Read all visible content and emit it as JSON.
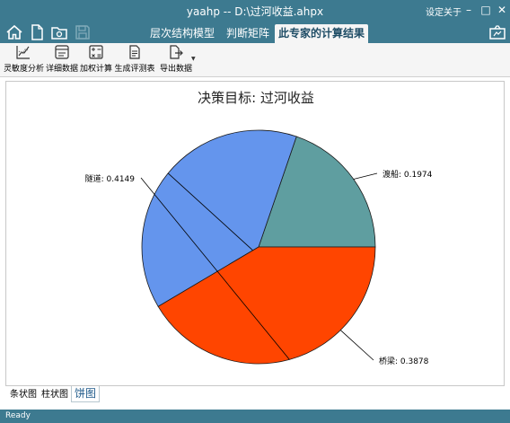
{
  "window": {
    "title": "yaahp -- D:\\过河收益.ahpx",
    "menu_settings": "设定",
    "menu_about": "关于"
  },
  "nav_tabs": [
    {
      "label": "层次结构模型",
      "active": false
    },
    {
      "label": "判断矩阵",
      "active": false
    },
    {
      "label": "此专家的计算结果",
      "active": true
    }
  ],
  "toolbar": [
    {
      "label": "灵敏度分析",
      "icon": "sensitivity-chart-icon"
    },
    {
      "label": "详细数据",
      "icon": "detail-data-icon"
    },
    {
      "label": "加权计算",
      "icon": "weighted-calc-icon"
    },
    {
      "label": "生成评测表",
      "icon": "generate-survey-icon"
    },
    {
      "label": "导出数据",
      "icon": "export-data-icon"
    }
  ],
  "chart_data": {
    "type": "pie",
    "title": "决策目标: 过河收益",
    "slices": [
      {
        "label": "渡船",
        "value": 0.1974,
        "color": "#5f9ea0"
      },
      {
        "label": "桥梁",
        "value": 0.3878,
        "color": "#6495ed"
      },
      {
        "label": "隧道",
        "value": 0.4149,
        "color": "#ff4500"
      }
    ]
  },
  "bottom_tabs": [
    {
      "label": "条状图",
      "active": false
    },
    {
      "label": "柱状图",
      "active": false
    },
    {
      "label": "饼图",
      "active": true
    }
  ],
  "status": "Ready",
  "colors": {
    "chrome": "#3d7a90",
    "active_tab_text": "#1f4d66"
  }
}
